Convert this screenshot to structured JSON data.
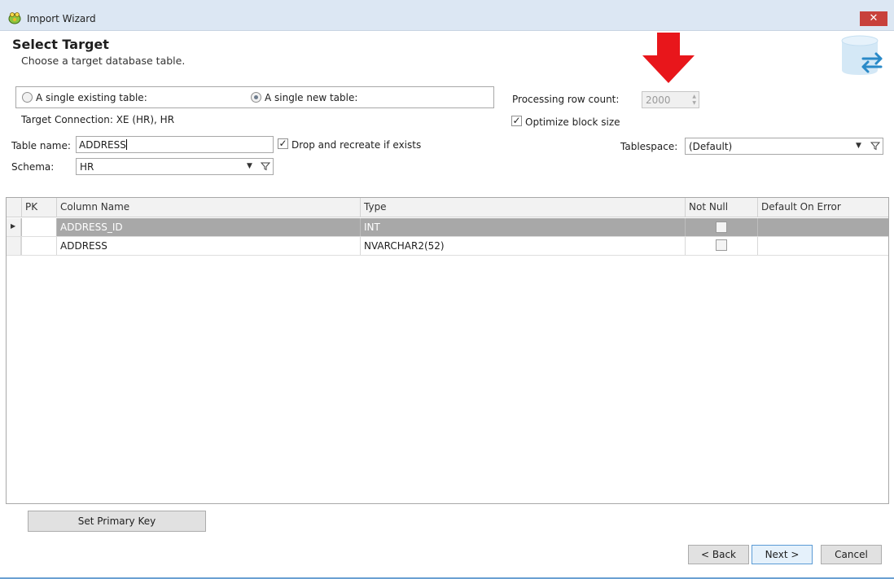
{
  "window": {
    "title": "Import Wizard",
    "close_glyph": "✕"
  },
  "header": {
    "title": "Select Target",
    "subtitle": "Choose a target database table.",
    "icon": "database-transfer-icon"
  },
  "annotation": {
    "icon": "red-arrow-down-icon",
    "color": "#e8161b"
  },
  "target_mode": {
    "existing_label": "A single existing table:",
    "new_label": "A single new table:",
    "selected": "new"
  },
  "connection": {
    "text": "Target Connection: XE (HR), HR"
  },
  "table_name": {
    "label": "Table name:",
    "value": "ADDRESS"
  },
  "drop_recreate": {
    "label": "Drop and recreate if exists",
    "checked": true
  },
  "schema": {
    "label": "Schema:",
    "value": "HR"
  },
  "processing": {
    "label": "Processing row count:",
    "value": "2000"
  },
  "optimize": {
    "label": "Optimize block size",
    "checked": true
  },
  "tablespace": {
    "label": "Tablespace:",
    "value": "(Default)"
  },
  "grid": {
    "columns": [
      "PK",
      "Column Name",
      "Type",
      "Not Null",
      "Default On Error"
    ],
    "rows": [
      {
        "pk": "",
        "name": "ADDRESS_ID",
        "type": "INT",
        "not_null": false,
        "default_on_error": "",
        "selected": true
      },
      {
        "pk": "",
        "name": "ADDRESS",
        "type": "NVARCHAR2(52)",
        "not_null": false,
        "default_on_error": "",
        "selected": false
      }
    ]
  },
  "buttons": {
    "set_pk": "Set Primary Key",
    "back": "< Back",
    "next": "Next >",
    "cancel": "Cancel"
  },
  "colors": {
    "titlebar": "#dce7f3",
    "close": "#c8413b",
    "selected_row": "#a8a8a8",
    "accent": "#6aa0d2"
  }
}
